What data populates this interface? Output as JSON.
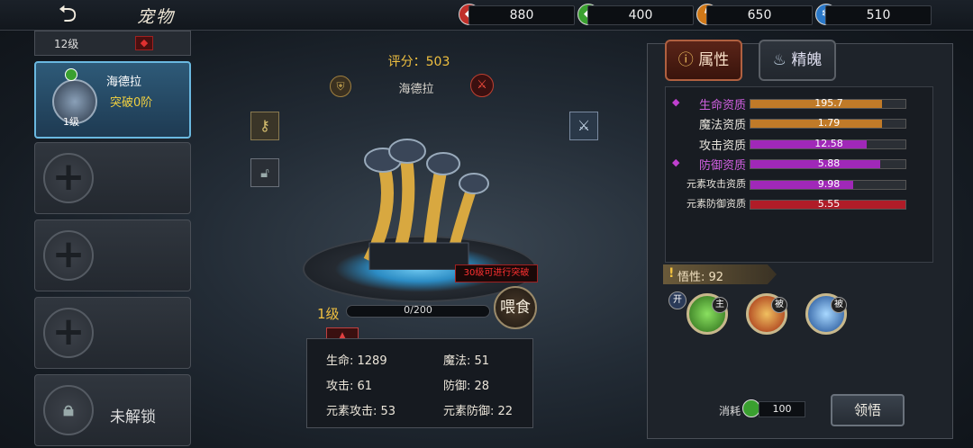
{
  "header": {
    "title": "宠物",
    "back_icon": "back-arrow-icon"
  },
  "resources": [
    {
      "icon": "red-crystal-icon",
      "color": "#c0302a",
      "value": "880"
    },
    {
      "icon": "green-crystal-icon",
      "color": "#3aa030",
      "value": "400"
    },
    {
      "icon": "lightning-crystal-icon",
      "color": "#d07818",
      "value": "650"
    },
    {
      "icon": "ice-crystal-icon",
      "color": "#2a78c8",
      "value": "510"
    }
  ],
  "pet_list": {
    "top_level": "12级",
    "selected": {
      "name": "海德拉",
      "breakthrough": "突破0阶",
      "level": "1级"
    },
    "locked_label": "未解锁"
  },
  "pet": {
    "score_label": "评分：503",
    "name": "海德拉",
    "level": "1级",
    "exp": "0/200",
    "exp_progress": 0,
    "breakthrough_hint": "30级可进行突破",
    "feed_button": "喂食"
  },
  "stats": [
    {
      "label": "生命: 1289"
    },
    {
      "label": "魔法: 51"
    },
    {
      "label": "攻击: 61"
    },
    {
      "label": "防御: 28"
    },
    {
      "label": "元素攻击: 53"
    },
    {
      "label": "元素防御: 22"
    }
  ],
  "tabs": [
    {
      "label": "属性",
      "icon": "info-icon"
    },
    {
      "label": "精魄",
      "icon": "flame-icon"
    }
  ],
  "aptitudes": [
    {
      "label": "生命资质",
      "value": "195.7",
      "fill": 0.85,
      "color": "#c07a28",
      "marked": true
    },
    {
      "label": "魔法资质",
      "value": "1.79",
      "fill": 0.85,
      "color": "#c07a28",
      "marked": false
    },
    {
      "label": "攻击资质",
      "value": "12.58",
      "fill": 0.75,
      "color": "#a028b8",
      "marked": false
    },
    {
      "label": "防御资质",
      "value": "5.88",
      "fill": 0.84,
      "color": "#a028b8",
      "marked": true
    },
    {
      "label": "元素攻击资质",
      "value": "9.98",
      "fill": 0.66,
      "color": "#a028b8",
      "marked": false
    },
    {
      "label": "元素防御资质",
      "value": "5.55",
      "fill": 1.0,
      "color": "#b01c28",
      "marked": false
    }
  ],
  "comprehension": {
    "label": "悟性: 92"
  },
  "skills": [
    {
      "badge": "主",
      "icon": "green-blast-skill-icon",
      "color": "#3a8a28"
    },
    {
      "badge": "被",
      "icon": "fire-slash-skill-icon",
      "color": "#b04018"
    },
    {
      "badge": "被",
      "icon": "ice-swirl-skill-icon",
      "color": "#2a6ab0"
    }
  ],
  "skill_toggle": "开",
  "cost": {
    "label": "消耗",
    "value": "100"
  },
  "comprehend_button": "领悟"
}
